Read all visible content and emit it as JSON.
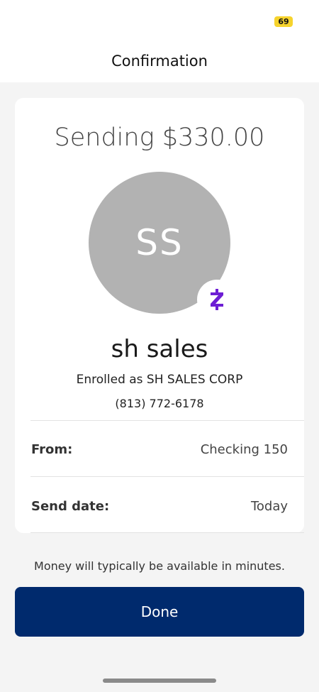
{
  "status_bar": {
    "battery_level": "69"
  },
  "header": {
    "title": "Confirmation"
  },
  "confirmation": {
    "amount_text": "Sending $330.00",
    "recipient_initials": "SS",
    "recipient_name": "sh sales",
    "enrolled_text": "Enrolled as SH SALES CORP",
    "phone": "(813) 772-6178",
    "payment_network_icon": "zelle-icon",
    "details": [
      {
        "label": "From:",
        "value": "Checking 150"
      },
      {
        "label": "Send date:",
        "value": "Today"
      }
    ]
  },
  "footnote": "Money will typically be available in minutes.",
  "actions": {
    "done_label": "Done"
  },
  "colors": {
    "primary_button": "#002a6d",
    "zelle_purple": "#6d1ed4",
    "avatar_bg": "#b2b2b2",
    "battery_badge": "#f6d32d"
  }
}
